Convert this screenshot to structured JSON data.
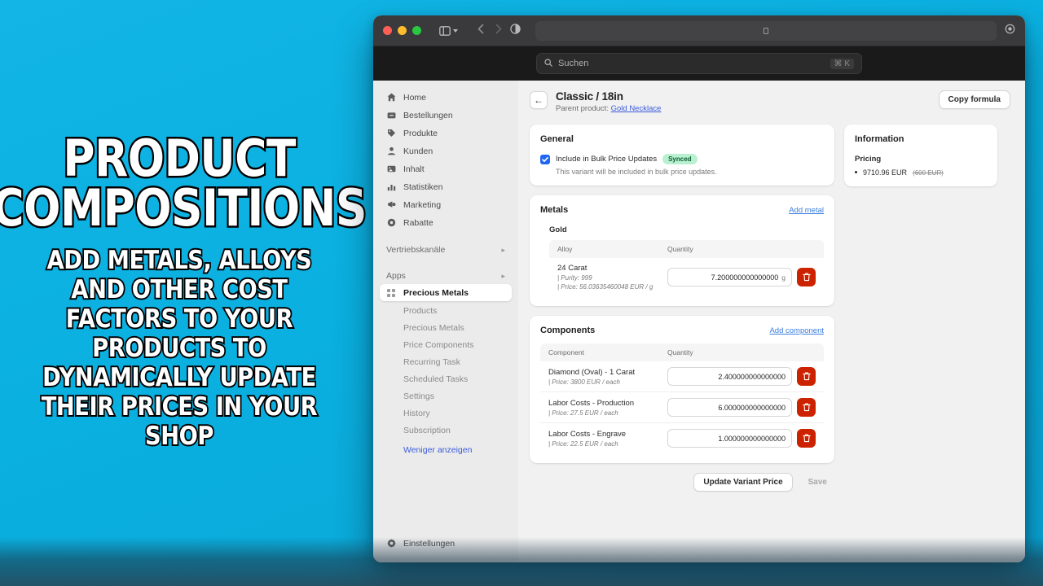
{
  "promo": {
    "title_line1": "PRODUCT",
    "title_line2": "COMPOSITIONS",
    "subtitle": "ADD METALS, ALLOYS AND OTHER COST FACTORS TO YOUR PRODUCTS TO DYNAMICALLY UPDATE THEIR PRICES IN YOUR SHOP",
    "bg_color": "#0cb3e0"
  },
  "browser": {
    "traffic_lights": [
      "close",
      "minimize",
      "zoom"
    ],
    "sidebar_toggle_icon": "sidebar-icon",
    "back_icon": "chevron-left-icon",
    "forward_icon": "chevron-right-icon",
    "reader_icon": "contrast-icon",
    "url_value": "",
    "extension_icon": "puzzle-icon"
  },
  "app_search": {
    "icon": "search-icon",
    "placeholder": "Suchen",
    "shortcut": "⌘ K"
  },
  "sidebar": {
    "items": [
      {
        "label": "Home",
        "icon": "home-icon"
      },
      {
        "label": "Bestellungen",
        "icon": "orders-icon"
      },
      {
        "label": "Produkte",
        "icon": "tag-icon"
      },
      {
        "label": "Kunden",
        "icon": "person-icon"
      },
      {
        "label": "Inhalt",
        "icon": "content-icon"
      },
      {
        "label": "Statistiken",
        "icon": "chart-icon"
      },
      {
        "label": "Marketing",
        "icon": "megaphone-icon"
      },
      {
        "label": "Rabatte",
        "icon": "discount-icon"
      }
    ],
    "group_sales": {
      "label": "Vertriebskanäle",
      "chevron": "chevron-right-icon"
    },
    "group_apps": {
      "label": "Apps",
      "chevron": "chevron-right-icon"
    },
    "active_app": {
      "label": "Precious Metals",
      "icon": "app-icon"
    },
    "app_subitems": [
      "Products",
      "Precious Metals",
      "Price Components",
      "Recurring Task",
      "Scheduled Tasks",
      "Settings",
      "History",
      "Subscription"
    ],
    "show_less_label": "Weniger anzeigen",
    "settings": {
      "label": "Einstellungen",
      "icon": "gear-icon"
    }
  },
  "header": {
    "back_icon": "arrow-left-icon",
    "title": "Classic / 18in",
    "parent_prefix": "Parent product:",
    "parent_link": "Gold Necklace",
    "copy_formula_label": "Copy formula"
  },
  "general": {
    "title": "General",
    "checkbox_label": "Include in Bulk Price Updates",
    "checkbox_checked": true,
    "badge": "Synced",
    "help_text": "This variant will be included in bulk price updates."
  },
  "metals": {
    "title": "Metals",
    "add_link": "Add metal",
    "group_title": "Gold",
    "columns": [
      "Alloy",
      "Quantity"
    ],
    "rows": [
      {
        "name": "24 Carat",
        "purity": "| Purity: 999",
        "price": "| Price: 56.03635460048 EUR / g",
        "quantity": "7.200000000000000",
        "unit": "g",
        "delete_icon": "trash-icon"
      }
    ]
  },
  "components": {
    "title": "Components",
    "add_link": "Add component",
    "columns": [
      "Component",
      "Quantity"
    ],
    "rows": [
      {
        "name": "Diamond (Oval) - 1 Carat",
        "price": "| Price: 3800 EUR / each",
        "quantity": "2.400000000000000",
        "delete_icon": "trash-icon"
      },
      {
        "name": "Labor Costs - Production",
        "price": "| Price: 27.5 EUR / each",
        "quantity": "6.000000000000000",
        "delete_icon": "trash-icon"
      },
      {
        "name": "Labor Costs - Engrave",
        "price": "| Price: 22.5 EUR / each",
        "quantity": "1.000000000000000",
        "delete_icon": "trash-icon"
      }
    ]
  },
  "information": {
    "title": "Information",
    "pricing_label": "Pricing",
    "price_current": "9710.96 EUR",
    "price_old": "(600 EUR)"
  },
  "footer": {
    "update_label": "Update Variant Price",
    "save_label": "Save"
  }
}
